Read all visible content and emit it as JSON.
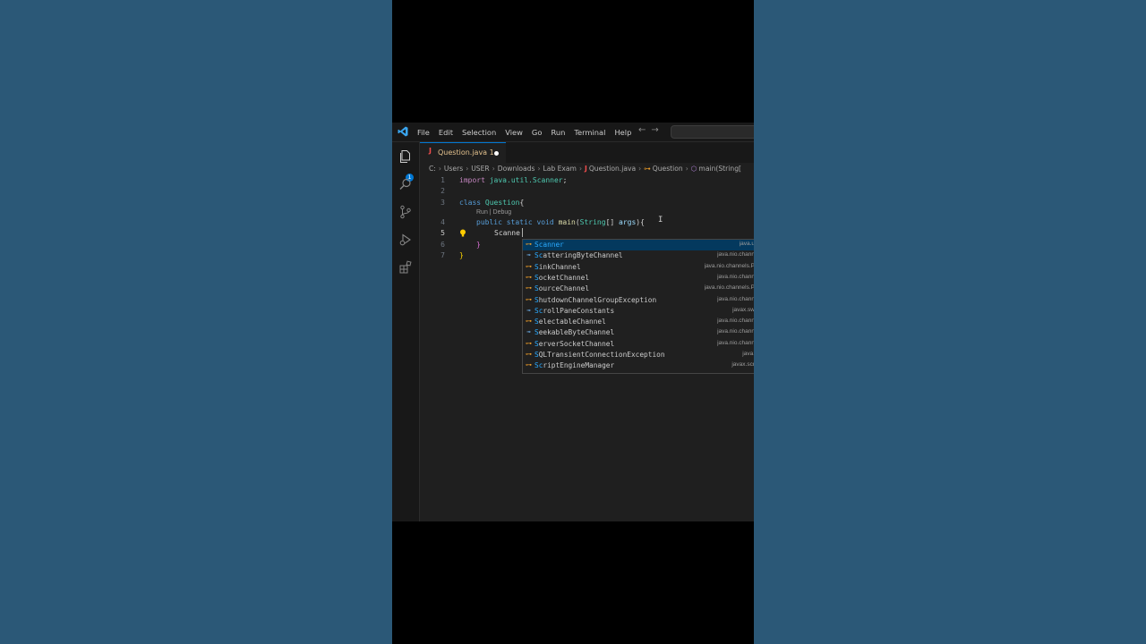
{
  "menu": [
    "File",
    "Edit",
    "Selection",
    "View",
    "Go",
    "Run",
    "Terminal",
    "Help"
  ],
  "activity_badge": "1",
  "tab": {
    "icon": "J",
    "label": "Question.java 1"
  },
  "breadcrumb": {
    "path": [
      "C:",
      "Users",
      "USER",
      "Downloads",
      "Lab Exam"
    ],
    "file_icon": "J",
    "file": "Question.java",
    "class": "Question",
    "method": "main(String["
  },
  "codelens": "Run | Debug",
  "editor": {
    "line_numbers": [
      "1",
      "2",
      "3",
      "4",
      "5",
      "6",
      "7"
    ],
    "typed": "Scanne"
  },
  "suggestions": [
    {
      "pre": "",
      "match": "Scanner",
      "post": "",
      "detail": "java.u",
      "kind": "class"
    },
    {
      "pre": "",
      "match": "Sc",
      "post": "atteringByteChannel",
      "detail": "java.nio.chann",
      "kind": "interface"
    },
    {
      "pre": "",
      "match": "S",
      "post": "inkChannel",
      "detail": "java.nio.channels.P",
      "kind": "class"
    },
    {
      "pre": "",
      "match": "S",
      "post": "ocketChannel",
      "detail": "java.nio.chann",
      "kind": "class"
    },
    {
      "pre": "",
      "match": "S",
      "post": "ourceChannel",
      "detail": "java.nio.channels.P",
      "kind": "class"
    },
    {
      "pre": "",
      "match": "S",
      "post": "hutdownChannelGroupException",
      "detail": "java.nio.chann",
      "kind": "class"
    },
    {
      "pre": "",
      "match": "Sc",
      "post": "rollPaneConstants",
      "detail": "javax.sw",
      "kind": "interface"
    },
    {
      "pre": "",
      "match": "S",
      "post": "electableChannel",
      "detail": "java.nio.chann",
      "kind": "class"
    },
    {
      "pre": "",
      "match": "S",
      "post": "eekableByteChannel",
      "detail": "java.nio.chann",
      "kind": "interface"
    },
    {
      "pre": "",
      "match": "S",
      "post": "erverSocketChannel",
      "detail": "java.nio.chann",
      "kind": "class"
    },
    {
      "pre": "",
      "match": "S",
      "post": "QLTransientConnectionException",
      "detail": "java.",
      "kind": "class"
    },
    {
      "pre": "",
      "match": "Sc",
      "post": "riptEngineManager",
      "detail": "javax.scr",
      "kind": "class"
    }
  ],
  "colors": {
    "accent": "#0078d4",
    "editor_bg": "#1f1f1f",
    "page_bg": "#2b5877"
  }
}
